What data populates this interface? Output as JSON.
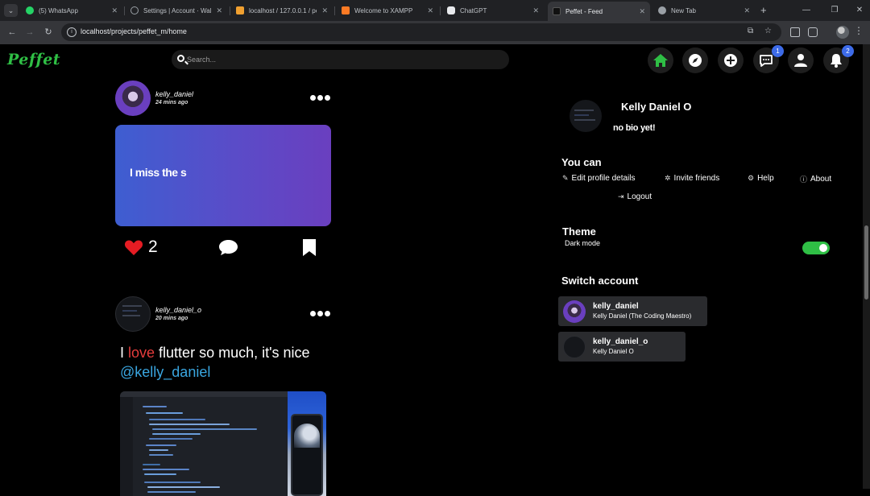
{
  "browser": {
    "tabs": [
      {
        "title": "(5) WhatsApp",
        "fav_color": "#25d366",
        "active": false
      },
      {
        "title": "Settings | Account · Wake",
        "fav_color": "#202124",
        "active": false
      },
      {
        "title": "localhost / 127.0.0.1 / pe",
        "fav_color": "#f0a030",
        "active": false
      },
      {
        "title": "Welcome to XAMPP",
        "fav_color": "#fb7a24",
        "active": false
      },
      {
        "title": "ChatGPT",
        "fav_color": "#e8eaed",
        "active": false
      },
      {
        "title": "Peffet - Feed",
        "fav_color": "#111111",
        "active": true
      },
      {
        "title": "New Tab",
        "fav_color": "#9aa0a6",
        "active": false
      }
    ],
    "url": "localhost/projects/peffet_m/home"
  },
  "header": {
    "logo": "Peffet",
    "search_placeholder": "Search...",
    "messages_badge": "1",
    "notifications_badge": "2",
    "accent_color": "#2fbf45"
  },
  "feed": {
    "posts": [
      {
        "username": "kelly_daniel",
        "time": "24 mins ago",
        "card_text": "I miss the s",
        "likes": "2"
      },
      {
        "username": "kelly_daniel_o",
        "time": "20 mins ago",
        "text_before": "I ",
        "text_highlight": "love",
        "text_after": " flutter so much, it's nice",
        "mention": "@kelly_daniel"
      }
    ]
  },
  "profile": {
    "name": "Kelly Daniel O",
    "bio": "no bio yet!"
  },
  "you_can": {
    "heading": "You can",
    "links": {
      "edit": "Edit profile details",
      "invite": "Invite friends",
      "help": "Help",
      "about": "About",
      "logout": "Logout"
    }
  },
  "theme": {
    "heading": "Theme",
    "label": "Dark mode",
    "dark_mode": true
  },
  "switch_account": {
    "heading": "Switch account",
    "accounts": [
      {
        "username": "kelly_daniel",
        "name": "Kelly Daniel (The Coding Maestro)"
      },
      {
        "username": "kelly_daniel_o",
        "name": "Kelly Daniel O"
      }
    ]
  }
}
